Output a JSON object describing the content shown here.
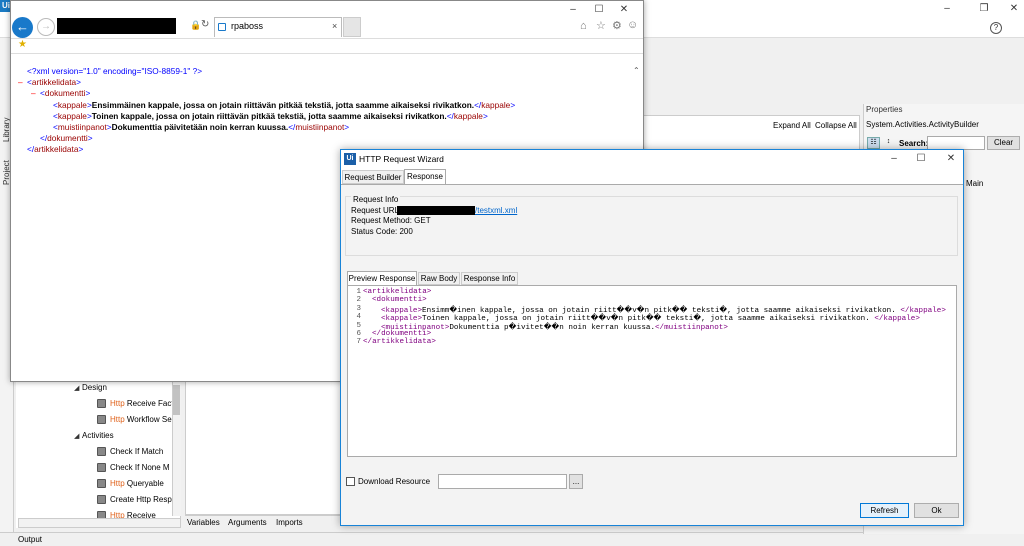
{
  "studio": {
    "logo": "Ui",
    "help_icon": "?",
    "vertical_tabs": {
      "library": "Library",
      "project": "Project"
    },
    "activities": [
      {
        "kind": "group",
        "label": "Design"
      },
      {
        "kind": "item",
        "http": "Http",
        "label": " Receive Fact"
      },
      {
        "kind": "item",
        "http": "Http",
        "label": " Workflow Se"
      },
      {
        "kind": "group",
        "label": "Activities"
      },
      {
        "kind": "item",
        "http": "",
        "label": "Check If Match"
      },
      {
        "kind": "item",
        "http": "",
        "label": "Check If None M"
      },
      {
        "kind": "item",
        "http": "Http",
        "label": " Queryable"
      },
      {
        "kind": "item",
        "http": "",
        "label": "Create Http Resp"
      },
      {
        "kind": "item",
        "http": "Http",
        "label": " Receive"
      }
    ],
    "designer": {
      "expand_all": "Expand All",
      "collapse_all": "Collapse All"
    },
    "bottom_tabs": {
      "variables": "Variables",
      "arguments": "Arguments",
      "imports": "Imports"
    },
    "output": "Output",
    "properties": {
      "title": "Properties",
      "type": "System.Activities.ActivityBuilder",
      "search_label": "Search:",
      "clear": "Clear",
      "main": "Main"
    }
  },
  "browser": {
    "tab_title": "rpaboss",
    "tab_close": "×",
    "xml_lines": [
      {
        "indent": 0,
        "sign": "",
        "kind": "decl",
        "text": "<?xml version=\"1.0\" encoding=\"ISO-8859-1\" ?>"
      },
      {
        "indent": 0,
        "sign": "–",
        "kind": "open",
        "tag": "artikkelidata"
      },
      {
        "indent": 1,
        "sign": "–",
        "kind": "open",
        "tag": "dokumentti"
      },
      {
        "indent": 2,
        "sign": "",
        "kind": "elem",
        "tag": "kappale",
        "text": "Ensimmäinen kappale, jossa on jotain riittävän pitkää tekstiä, jotta saamme aikaiseksi rivikatkon."
      },
      {
        "indent": 2,
        "sign": "",
        "kind": "elem",
        "tag": "kappale",
        "text": "Toinen kappale, jossa on jotain riittävän pitkää tekstiä, jotta saamme aikaiseksi rivikatkon."
      },
      {
        "indent": 2,
        "sign": "",
        "kind": "elem",
        "tag": "muistiinpanot",
        "text": "Dokumenttia päivitetään noin kerran kuussa."
      },
      {
        "indent": 1,
        "sign": "",
        "kind": "close",
        "tag": "dokumentti"
      },
      {
        "indent": 0,
        "sign": "",
        "kind": "close",
        "tag": "artikkelidata"
      }
    ]
  },
  "wizard": {
    "logo": "Ui",
    "title": "HTTP Request Wizard",
    "tabs": {
      "builder": "Request Builder",
      "response": "Response"
    },
    "request_info": {
      "title": "Request Info",
      "url_label": "Request URL:",
      "url_tail": "/testxml.xml",
      "method": "Request Method: GET",
      "status": "Status Code: 200"
    },
    "response_tabs": {
      "preview": "Preview Response",
      "raw": "Raw Body",
      "info": "Response Info"
    },
    "code_lines": [
      {
        "n": "1",
        "indent": 0,
        "open": "<artikkelidata>",
        "text": "",
        "close": ""
      },
      {
        "n": "2",
        "indent": 1,
        "open": "<dokumentti>",
        "text": "",
        "close": ""
      },
      {
        "n": "3",
        "indent": 2,
        "open": "<kappale>",
        "text": "Ensimm�inen kappale, jossa on jotain riitt��v�n pitk�� teksti�, jotta saamme aikaiseksi rivikatkon. ",
        "close": "</kappale>"
      },
      {
        "n": "4",
        "indent": 2,
        "open": "<kappale>",
        "text": "Toinen kappale, jossa on jotain riitt��v�n pitk�� teksti�, jotta saamme aikaiseksi rivikatkon. ",
        "close": "</kappale>"
      },
      {
        "n": "5",
        "indent": 2,
        "open": "<muistiinpanot>",
        "text": "Dokumenttia p�ivitet��n noin kerran kuussa.",
        "close": "</muistiinpanot>"
      },
      {
        "n": "6",
        "indent": 1,
        "open": "</dokumentti>",
        "text": "",
        "close": ""
      },
      {
        "n": "7",
        "indent": 0,
        "open": "</artikkelidata>",
        "text": "",
        "close": ""
      }
    ],
    "download_label": "Download Resource",
    "browse": "...",
    "refresh": "Refresh",
    "ok": "Ok"
  }
}
